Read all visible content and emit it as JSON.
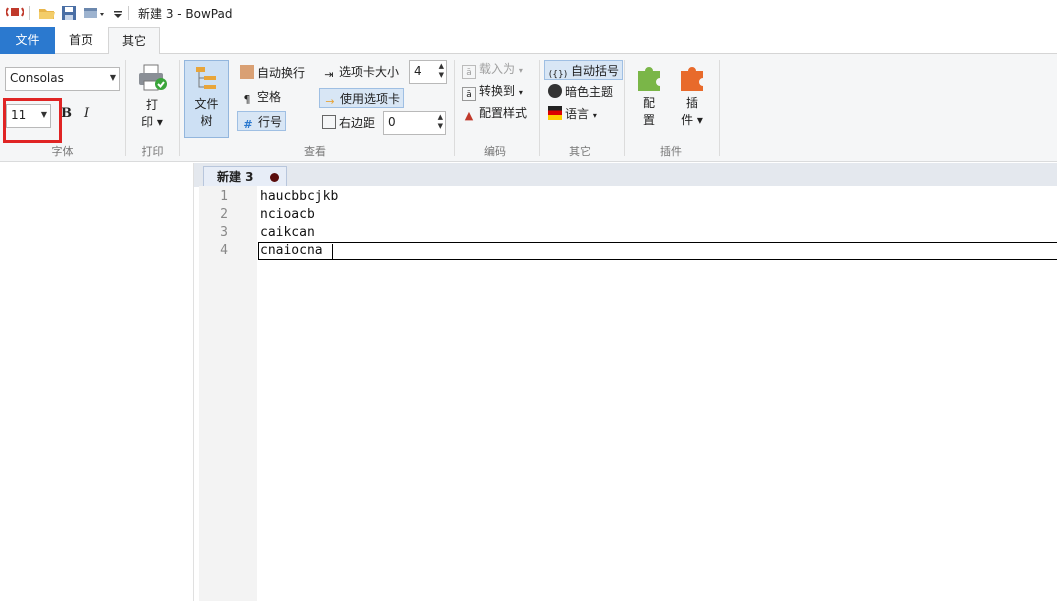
{
  "window": {
    "title": "新建 3 - BowPad"
  },
  "ribbon_tabs": [
    {
      "label": "文件"
    },
    {
      "label": "首页"
    },
    {
      "label": "其它",
      "selected": true
    }
  ],
  "font_group": {
    "font_name": "Consolas",
    "font_size": "11",
    "bold_label": "B",
    "italic_label": "I",
    "group_label": "字体"
  },
  "print_group": {
    "print_label_1": "打",
    "print_label_2": "印 ▾",
    "group_label": "打印"
  },
  "view_group": {
    "file_tree_1": "文件",
    "file_tree_2": "树",
    "word_wrap": "自动换行",
    "whitespace": "空格",
    "line_numbers": "行号",
    "tab_size_label": "选项卡大小",
    "tab_size_value": "4",
    "use_tabs": "使用选项卡",
    "right_margin_label": "右边距",
    "right_margin_value": "0",
    "group_label": "查看"
  },
  "encoding_group": {
    "load_as": "载入为",
    "convert_to": "转换到",
    "config_style": "配置样式",
    "group_label": "编码"
  },
  "other_group": {
    "auto_brace": "自动括号",
    "dark_theme": "暗色主题",
    "language": "语言",
    "group_label": "其它"
  },
  "plugins_group": {
    "config_1": "配",
    "config_2": "置",
    "plugin_1": "插",
    "plugin_2": "件 ▾",
    "group_label": "插件"
  },
  "editor": {
    "tab_label": "新建 3",
    "lines": [
      {
        "number": "1",
        "text": "haucbbcjkb"
      },
      {
        "number": "2",
        "text": "ncioacb"
      },
      {
        "number": "3",
        "text": "caikcan"
      },
      {
        "number": "4",
        "text": "cnaiocna"
      }
    ]
  },
  "colors": {
    "accent": "#2b79cf",
    "annotation_red": "#e02424"
  }
}
